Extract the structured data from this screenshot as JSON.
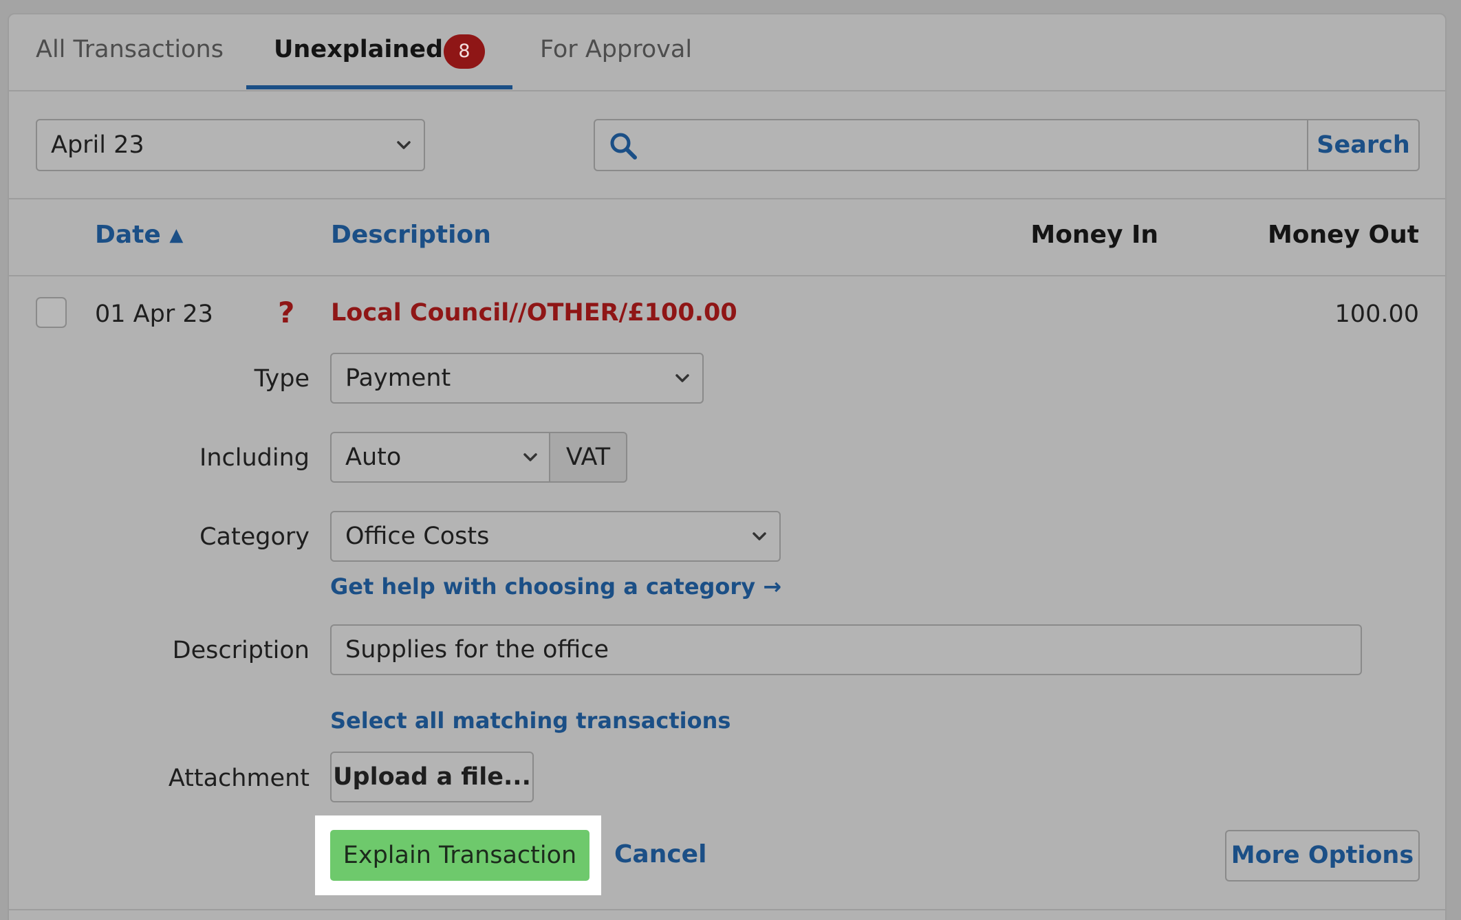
{
  "tabs": [
    {
      "label": "All Transactions"
    },
    {
      "label": "Unexplained",
      "badge": "8"
    },
    {
      "label": "For Approval"
    }
  ],
  "filters": {
    "period_value": "April 23",
    "search_value": "",
    "search_button": "Search"
  },
  "table": {
    "columns": [
      "Date",
      "Description",
      "Money In",
      "Money Out"
    ],
    "sort_indicator": "▲"
  },
  "transaction": {
    "date": "01 Apr 23",
    "status_icon": "?",
    "description": "Local Council//OTHER/£100.00",
    "money_in": "",
    "money_out": "100.00"
  },
  "form": {
    "type_label": "Type",
    "type_value": "Payment",
    "including_label": "Including",
    "including_value": "Auto",
    "vat_label": "VAT",
    "category_label": "Category",
    "category_value": "Office Costs",
    "category_help_link": "Get help with choosing a category →",
    "description_label": "Description",
    "description_value": "Supplies for the office",
    "select_matching_link": "Select all matching transactions",
    "attachment_label": "Attachment",
    "upload_button": "Upload a file..."
  },
  "actions": {
    "explain": "Explain Transaction",
    "cancel": "Cancel",
    "more_options": "More Options"
  },
  "colors": {
    "accent_blue": "#1b4f86",
    "alert_red": "#8f1616",
    "primary_green": "#6ec96c"
  }
}
